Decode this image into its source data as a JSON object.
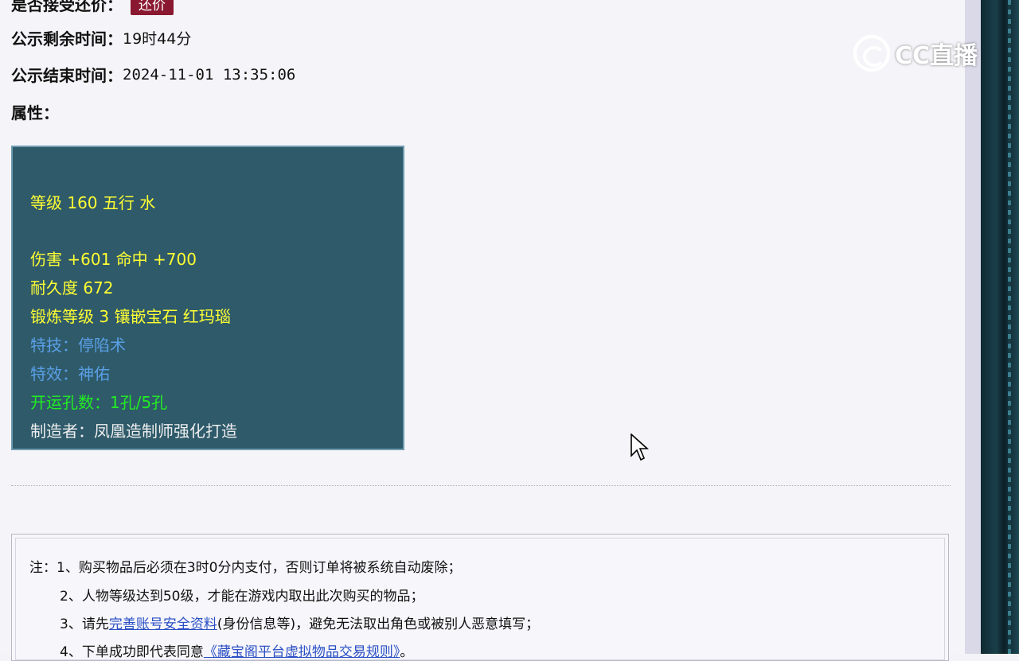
{
  "fields": {
    "accept_counter": {
      "label": "是否接受还价：",
      "button": "还价"
    },
    "remaining": {
      "label": "公示剩余时间：",
      "value": "19时44分"
    },
    "end_time": {
      "label": "公示结束时间：",
      "value": "2024-11-01 13:35:06"
    },
    "attrs_label": "属性："
  },
  "attributes": {
    "line1": "等级 160 五行 水",
    "line2": "伤害 +601 命中 +700",
    "line3": "耐久度 672",
    "line4": "锻炼等级 3 镶嵌宝石 红玛瑙",
    "line5": "特技：停陷术",
    "line6": "特效：神佑",
    "line7": "开运孔数：1孔/5孔",
    "line8": "制造者：凤凰造制师强化打造"
  },
  "notes": {
    "n1": "注：1、购买物品后必须在3时0分内支付，否则订单将被系统自动废除；",
    "n2": "2、人物等级达到50级，才能在游戏内取出此次购买的物品；",
    "n3_pre": "3、请先",
    "n3_link": "完善账号安全资料",
    "n3_post": "(身份信息等)，避免无法取出角色或被别人恶意填写；",
    "n4_pre": "4、下单成功即代表同意",
    "n4_link": "《藏宝阁平台虚拟物品交易规则》",
    "n4_post": "。"
  },
  "watermark": {
    "text": "CC直播"
  },
  "colors": {
    "box_bg": "#2e5a6a",
    "yellow": "#ffff33",
    "blue": "#5aa0e6",
    "green": "#22ee22",
    "button": "#8a1830"
  }
}
